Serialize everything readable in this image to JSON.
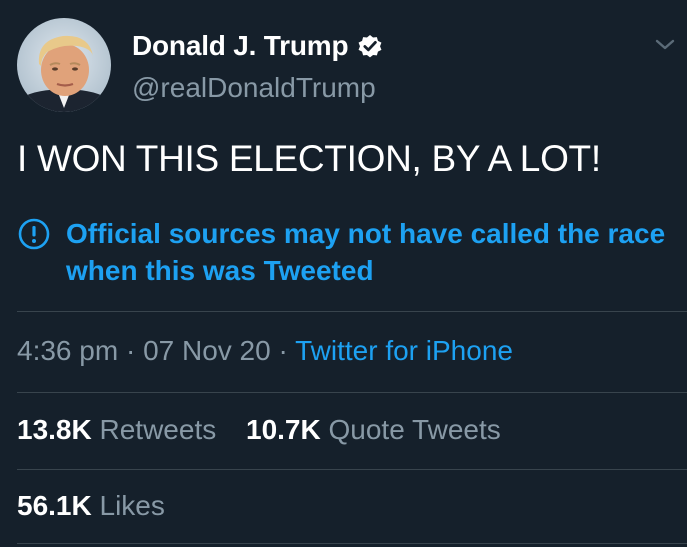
{
  "author": {
    "display_name": "Donald J. Trump",
    "handle": "@realDonaldTrump",
    "verified": true
  },
  "icons": {
    "verified": "verified-badge-icon",
    "menu": "chevron-down-icon",
    "notice": "exclamation-circle-icon"
  },
  "tweet": {
    "text": "I WON THIS ELECTION, BY A LOT!",
    "notice": "Official sources may not have called the race when this was Tweeted",
    "time": "4:36 pm",
    "separator": "·",
    "date": "07 Nov 20",
    "source": "Twitter for iPhone"
  },
  "stats": {
    "retweets_count": "13.8K",
    "retweets_label": "Retweets",
    "quote_count": "10.7K",
    "quote_label": "Quote Tweets",
    "likes_count": "56.1K",
    "likes_label": "Likes"
  },
  "colors": {
    "background": "#15202b",
    "accent": "#1da1f2",
    "secondary_text": "#8899a6",
    "divider": "#38444d"
  }
}
